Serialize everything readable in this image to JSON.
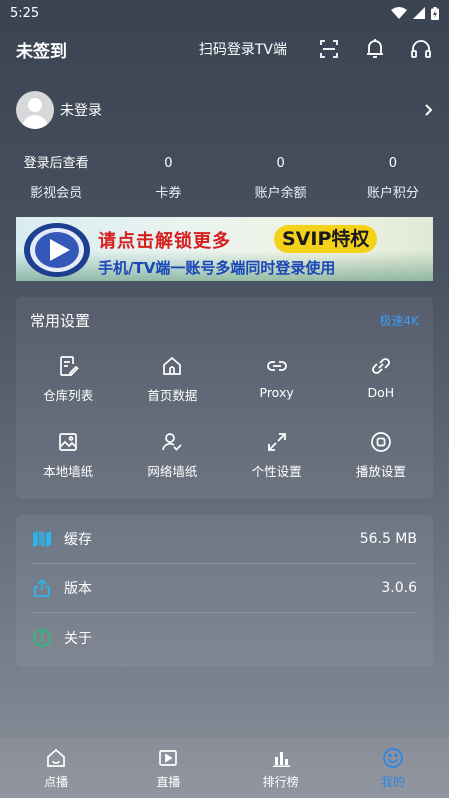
{
  "status": {
    "time": "5:25"
  },
  "header": {
    "title": "未签到",
    "scan_label": "扫码登录TV端"
  },
  "user": {
    "name": "未登录"
  },
  "stats": [
    {
      "value": "登录后查看",
      "label": "影视会员"
    },
    {
      "value": "0",
      "label": "卡券"
    },
    {
      "value": "0",
      "label": "账户余额"
    },
    {
      "value": "0",
      "label": "账户积分"
    }
  ],
  "banner": {
    "line1": "请点击解锁更多",
    "svip": "SVIP特权",
    "line2": "手机/TV端一账号多端同时登录使用"
  },
  "settings": {
    "title": "常用设置",
    "link": "极速4K",
    "items": [
      {
        "label": "仓库列表",
        "icon": "document-edit-icon"
      },
      {
        "label": "首页数据",
        "icon": "home-icon"
      },
      {
        "label": "Proxy",
        "icon": "link-icon"
      },
      {
        "label": "DoH",
        "icon": "chain-icon"
      },
      {
        "label": "本地墙纸",
        "icon": "image-icon"
      },
      {
        "label": "网络墙纸",
        "icon": "user-check-icon"
      },
      {
        "label": "个性设置",
        "icon": "expand-arrows-icon"
      },
      {
        "label": "播放设置",
        "icon": "record-icon"
      }
    ]
  },
  "info": [
    {
      "label": "缓存",
      "value": "56.5 MB",
      "icon": "map-icon"
    },
    {
      "label": "版本",
      "value": "3.0.6",
      "icon": "share-upload-icon"
    },
    {
      "label": "关于",
      "value": "",
      "icon": "info-icon"
    }
  ],
  "nav": [
    {
      "label": "点播",
      "icon": "home-tv-icon"
    },
    {
      "label": "直播",
      "icon": "play-icon"
    },
    {
      "label": "排行榜",
      "icon": "bar-chart-icon"
    },
    {
      "label": "我的",
      "icon": "smile-icon"
    }
  ],
  "colors": {
    "accent": "#2d86e6",
    "link": "#3d9df2",
    "info_icon": "#2fb2e6",
    "about_icon": "#2bbd7e"
  }
}
